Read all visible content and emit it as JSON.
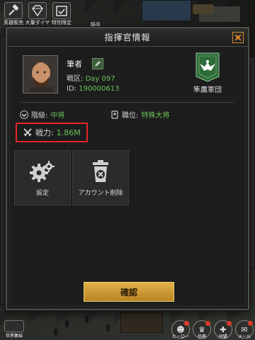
{
  "top_hud": {
    "buttons": [
      {
        "label": "英雄販売",
        "icon": "hammer-icon"
      },
      {
        "label": "大量ダイヤ",
        "icon": "diamond-icon"
      },
      {
        "label": "特別限定",
        "icon": "calendar-check-icon"
      }
    ],
    "extra_label": "騎兵"
  },
  "dialog": {
    "title": "指揮官情報",
    "close_icon": "close-icon",
    "profile": {
      "name": "筆者",
      "zone_label": "戦区:",
      "zone_value": "Day 097",
      "id_label": "ID:",
      "id_value": "190000613"
    },
    "legion": {
      "name": "隼鷹軍団",
      "icon": "eagle-emblem-icon"
    },
    "stats": {
      "rank_label": "階級:",
      "rank_value": "中将",
      "post_label": "職位:",
      "post_value": "特殊大将",
      "power_label": "戦力:",
      "power_value": "1.86M"
    },
    "tiles": [
      {
        "label": "設定",
        "icon": "gears-icon"
      },
      {
        "label": "アカウント削除",
        "icon": "trash-x-icon"
      }
    ],
    "confirm_label": "確認"
  },
  "bottom_hud": {
    "left_label": "世界集結",
    "right_buttons": [
      {
        "label": "ヒーロー",
        "icon": "hero-icon",
        "badge": true
      },
      {
        "label": "任務",
        "icon": "trophy-icon",
        "badge": true
      },
      {
        "label": "同盟",
        "icon": "alliance-icon",
        "badge": true
      },
      {
        "label": "メール",
        "icon": "mail-icon",
        "badge": true
      }
    ]
  },
  "colors": {
    "accent_green": "#6cc05c",
    "highlight_red": "#e8232a",
    "confirm_gold": "#d4a03a",
    "legion_green": "#2e6b3a"
  }
}
